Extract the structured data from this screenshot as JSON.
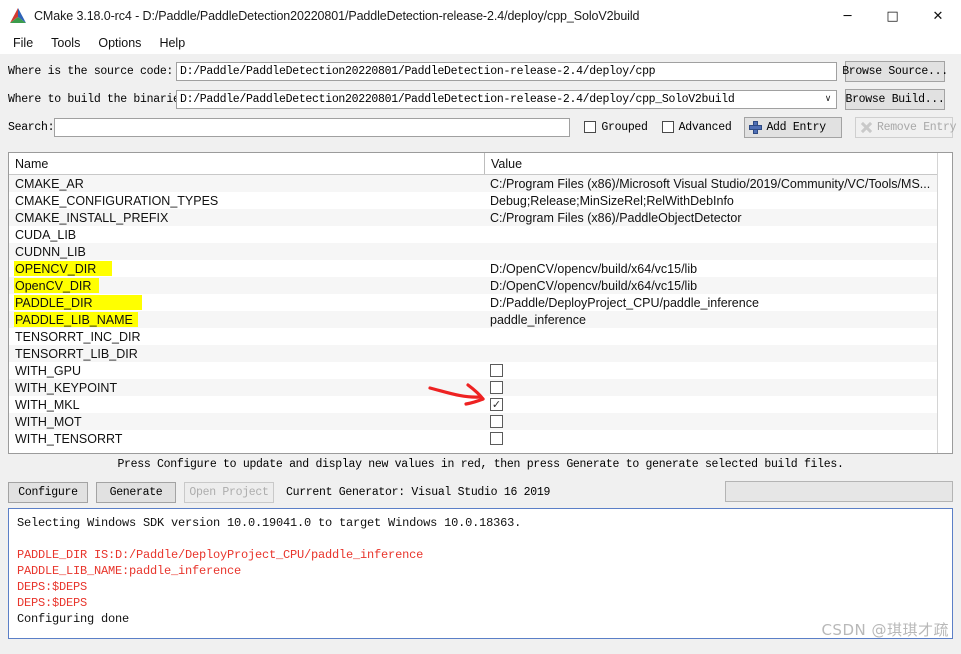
{
  "window": {
    "title": "CMake 3.18.0-rc4 - D:/Paddle/PaddleDetection20220801/PaddleDetection-release-2.4/deploy/cpp_SoloV2build",
    "app_icon": "cmake-logo-icon",
    "minimize": "─",
    "maximize": "□",
    "close": "✕"
  },
  "menubar": {
    "items": [
      {
        "label": "File"
      },
      {
        "label": "Tools"
      },
      {
        "label": "Options"
      },
      {
        "label": "Help"
      }
    ]
  },
  "form": {
    "source_label": "Where is the source code:",
    "source_value": "D:/Paddle/PaddleDetection20220801/PaddleDetection-release-2.4/deploy/cpp",
    "browse_source_label": "Browse Source...",
    "build_label": "Where to build the binaries:",
    "build_value": "D:/Paddle/PaddleDetection20220801/PaddleDetection-release-2.4/deploy/cpp_SoloV2build",
    "browse_build_label": "Browse Build...",
    "combo_arrow": "∨",
    "search_label": "Search:",
    "search_value": "",
    "search_placeholder": "",
    "grouped_label": "Grouped",
    "grouped_checked": false,
    "advanced_label": "Advanced",
    "advanced_checked": false,
    "add_entry_label": "Add Entry",
    "remove_entry_label": "Remove Entry",
    "remove_entry_disabled": true
  },
  "table": {
    "columns": [
      "Name",
      "Value"
    ],
    "rows": [
      {
        "name": "CMAKE_AR",
        "value": "C:/Program Files (x86)/Microsoft Visual Studio/2019/Community/VC/Tools/MS...",
        "type": "text",
        "highlight": 0
      },
      {
        "name": "CMAKE_CONFIGURATION_TYPES",
        "value": "Debug;Release;MinSizeRel;RelWithDebInfo",
        "type": "text",
        "highlight": 0
      },
      {
        "name": "CMAKE_INSTALL_PREFIX",
        "value": "C:/Program Files (x86)/PaddleObjectDetector",
        "type": "text",
        "highlight": 0
      },
      {
        "name": "CUDA_LIB",
        "value": "",
        "type": "text",
        "highlight": 0
      },
      {
        "name": "CUDNN_LIB",
        "value": "",
        "type": "text",
        "highlight": 0
      },
      {
        "name": "OPENCV_DIR",
        "value": "D:/OpenCV/opencv/build/x64/vc15/lib",
        "type": "text",
        "highlight": 98
      },
      {
        "name": "OpenCV_DIR",
        "value": "D:/OpenCV/opencv/build/x64/vc15/lib",
        "type": "text",
        "highlight": 85
      },
      {
        "name": "PADDLE_DIR",
        "value": "D:/Paddle/DeployProject_CPU/paddle_inference",
        "type": "text",
        "highlight": 128
      },
      {
        "name": "PADDLE_LIB_NAME",
        "value": "paddle_inference",
        "type": "text",
        "highlight": 124
      },
      {
        "name": "TENSORRT_INC_DIR",
        "value": "",
        "type": "text",
        "highlight": 0
      },
      {
        "name": "TENSORRT_LIB_DIR",
        "value": "",
        "type": "text",
        "highlight": 0
      },
      {
        "name": "WITH_GPU",
        "value": "",
        "type": "checkbox",
        "checked": false,
        "highlight": 0
      },
      {
        "name": "WITH_KEYPOINT",
        "value": "",
        "type": "checkbox",
        "checked": false,
        "highlight": 0
      },
      {
        "name": "WITH_MKL",
        "value": "",
        "type": "checkbox",
        "checked": true,
        "highlight": 0
      },
      {
        "name": "WITH_MOT",
        "value": "",
        "type": "checkbox",
        "checked": false,
        "highlight": 0
      },
      {
        "name": "WITH_TENSORRT",
        "value": "",
        "type": "checkbox",
        "checked": false,
        "highlight": 0
      }
    ],
    "checkbox_tick": "✓"
  },
  "annotation": {
    "arrow_color": "#ee2222",
    "arrow_target": "WITH_MKL checkbox",
    "highlight_color": "#ffff00"
  },
  "actions": {
    "hint": "Press Configure to update and display new values in red, then press Generate to generate selected build files.",
    "configure_label": "Configure",
    "generate_label": "Generate",
    "open_project_label": "Open Project",
    "open_project_disabled": true,
    "generator_label": "Current Generator: Visual Studio 16 2019",
    "progress_value": ""
  },
  "log": {
    "lines": [
      {
        "text": "Selecting Windows SDK version 10.0.19041.0 to target Windows 10.0.18363.",
        "color": "black"
      },
      {
        "text": "",
        "color": "blank"
      },
      {
        "text": "PADDLE_DIR IS:D:/Paddle/DeployProject_CPU/paddle_inference",
        "color": "red"
      },
      {
        "text": "PADDLE_LIB_NAME:paddle_inference",
        "color": "red"
      },
      {
        "text": "DEPS:$DEPS",
        "color": "red"
      },
      {
        "text": "DEPS:$DEPS",
        "color": "red"
      },
      {
        "text": "Configuring done",
        "color": "black"
      }
    ]
  },
  "watermark": {
    "text": "CSDN @琪琪才疏"
  }
}
